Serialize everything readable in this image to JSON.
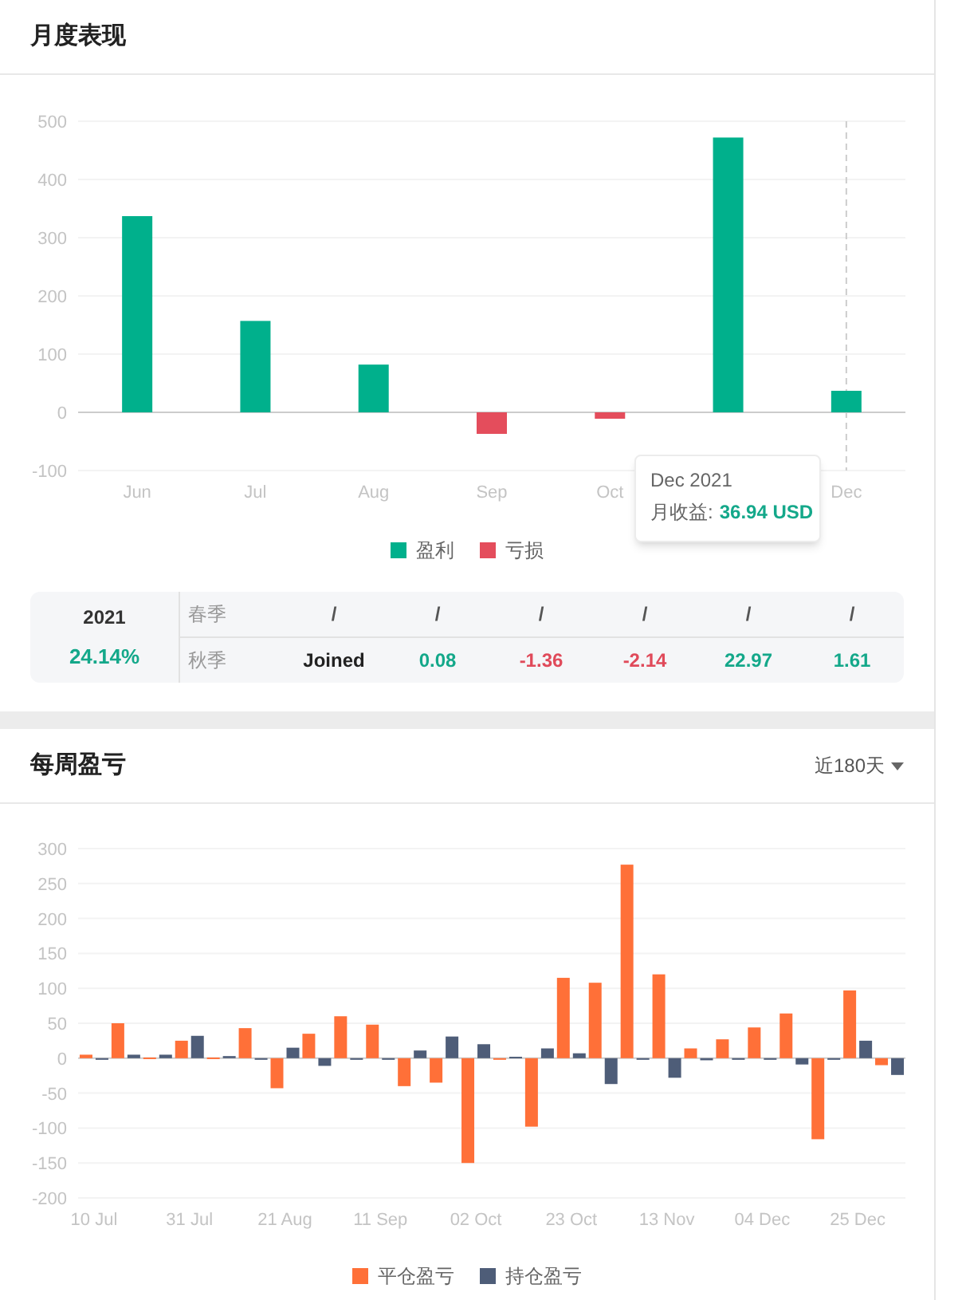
{
  "monthly": {
    "title": "月度表现",
    "chart_data": {
      "type": "bar",
      "categories": [
        "Jun",
        "Jul",
        "Aug",
        "Sep",
        "Oct",
        null,
        "Dec"
      ],
      "ref_lines": [
        {
          "axis": "x",
          "value": "Dec"
        }
      ],
      "series": [
        {
          "name": "盈利",
          "color": "#00b08c",
          "values": [
            337,
            157,
            82,
            null,
            null,
            472,
            37
          ]
        },
        {
          "name": "亏损",
          "color": "#e44d5c",
          "values": [
            null,
            null,
            null,
            -37,
            -11,
            null,
            null
          ]
        }
      ],
      "ylim": [
        -100,
        500
      ],
      "yticks": [
        -100,
        0,
        100,
        200,
        300,
        400,
        500
      ],
      "grid": true,
      "stacked": true
    },
    "tooltip": {
      "title": "Dec 2021",
      "label": "月收益:",
      "value": "36.94 USD"
    }
  },
  "summary": {
    "year": "2021",
    "return": "24.14%",
    "rows": [
      {
        "label": "春季",
        "cells": [
          {
            "text": "/",
            "color": "#555555"
          },
          {
            "text": "/",
            "color": "#555555"
          },
          {
            "text": "/",
            "color": "#555555"
          },
          {
            "text": "/",
            "color": "#555555"
          },
          {
            "text": "/",
            "color": "#555555"
          },
          {
            "text": "/",
            "color": "#555555"
          }
        ]
      },
      {
        "label": "秋季",
        "cells": [
          {
            "text": "Joined",
            "color": "#222222"
          },
          {
            "text": "0.08",
            "color": "#14a88a"
          },
          {
            "text": "-1.36",
            "color": "#e04a5a"
          },
          {
            "text": "-2.14",
            "color": "#e04a5a"
          },
          {
            "text": "22.97",
            "color": "#14a88a"
          },
          {
            "text": "1.61",
            "color": "#14a88a"
          }
        ]
      }
    ]
  },
  "weekly": {
    "title": "每周盈亏",
    "range": "近180天",
    "chart_data": {
      "type": "bar",
      "categories": [
        "10 Jul",
        null,
        null,
        "31 Jul",
        null,
        null,
        "21 Aug",
        null,
        null,
        "11 Sep",
        null,
        null,
        "02 Oct",
        null,
        null,
        "23 Oct",
        null,
        null,
        "13 Nov",
        null,
        null,
        "04 Dec",
        null,
        null,
        "25 Dec",
        null
      ],
      "grid": true,
      "series": [
        {
          "name": "平仓盈亏",
          "color": "#ff7038",
          "values": [
            5,
            50,
            1,
            25,
            1,
            43,
            -43,
            35,
            60,
            48,
            -40,
            -35,
            -150,
            -1,
            -98,
            115,
            108,
            277,
            120,
            14,
            27,
            44,
            64,
            -116,
            97,
            -10
          ]
        },
        {
          "name": "持仓盈亏",
          "color": "#4e5d78",
          "values": [
            0,
            5,
            5,
            32,
            3,
            0,
            15,
            -11,
            -2,
            0,
            11,
            31,
            20,
            2,
            14,
            7,
            -37,
            0,
            -28,
            -3,
            0,
            0,
            -9,
            0,
            25,
            -24
          ]
        }
      ],
      "ylim": [
        -200,
        300
      ],
      "yticks": [
        -200,
        -150,
        -100,
        -50,
        0,
        50,
        100,
        150,
        200,
        250,
        300
      ]
    }
  }
}
